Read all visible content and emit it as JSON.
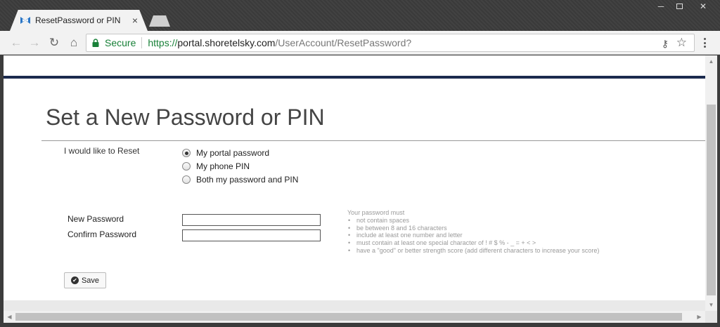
{
  "browser": {
    "tab_title": "ResetPassword or PIN",
    "tab_close": "×",
    "secure_label": "Secure",
    "url_scheme": "https://",
    "url_host": "portal.shoretelsky.com",
    "url_path": "/UserAccount/ResetPassword?",
    "nav_back": "←",
    "nav_forward": "→",
    "nav_reload": "↻",
    "nav_home": "⌂",
    "win_minimize": "─",
    "win_close": "✕",
    "key_glyph": "⚷",
    "star_glyph": "☆"
  },
  "page": {
    "title": "Set a New Password or PIN",
    "reset_label": "I would like to Reset",
    "options": [
      {
        "label": "My portal password",
        "checked": true
      },
      {
        "label": "My phone PIN",
        "checked": false
      },
      {
        "label": "Both my password and PIN",
        "checked": false
      }
    ],
    "new_password_label": "New Password",
    "confirm_password_label": "Confirm Password",
    "rules_heading": "Your password must",
    "rules": [
      "not contain spaces",
      "be between 8 and 16 characters",
      "include at least one number and letter",
      "must contain at least one special character of ! # $ % - _ = + < >",
      "have a \"good\" or better strength score (add different characters to increase your score)"
    ],
    "save_label": "Save",
    "save_icon": "✔"
  },
  "colors": {
    "accent_navy": "#1b2a4e",
    "secure_green": "#188038"
  }
}
